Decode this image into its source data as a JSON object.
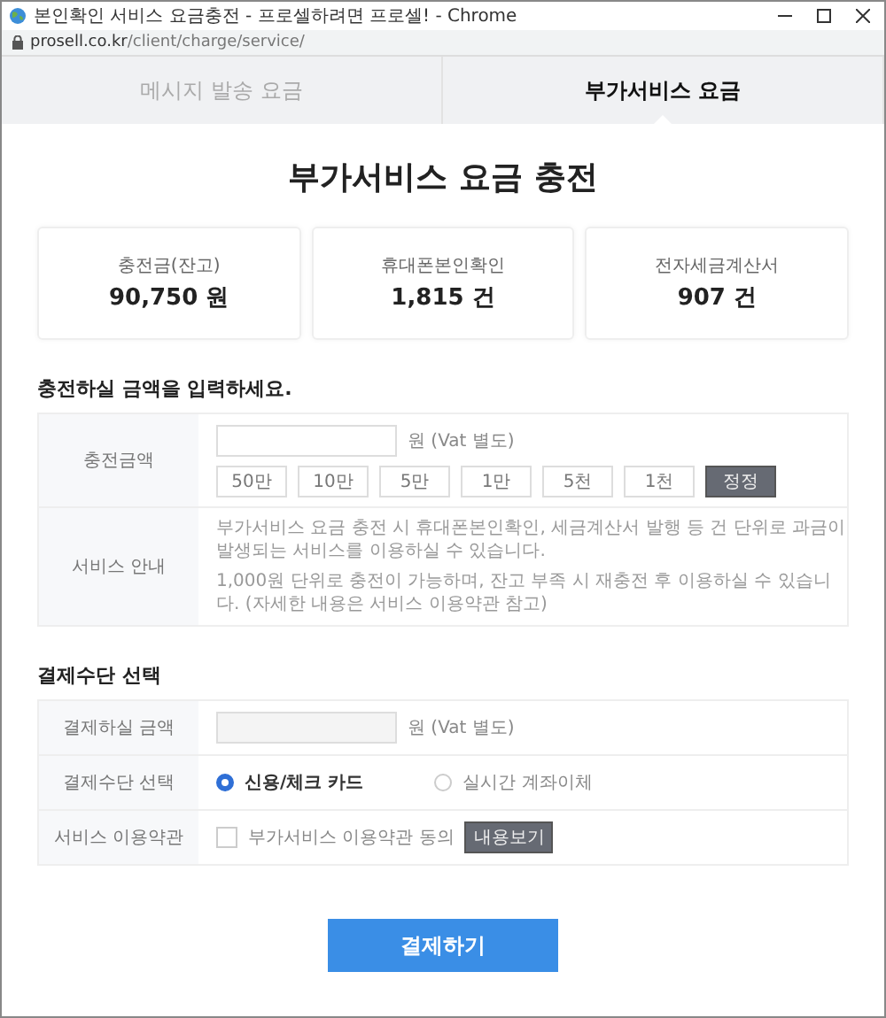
{
  "window": {
    "title": "본인확인 서비스 요금충전 - 프로셀하려면 프로셀! - Chrome",
    "url_domain": "prosell.co.kr",
    "url_path": "/client/charge/service/"
  },
  "tabs": [
    {
      "label": "메시지 발송 요금",
      "selected": false
    },
    {
      "label": "부가서비스 요금",
      "selected": true
    }
  ],
  "page_title": "부가서비스 요금 충전",
  "summary_cards": [
    {
      "label": "충전금(잔고)",
      "value": "90,750 원"
    },
    {
      "label": "휴대폰본인확인",
      "value": "1,815 건"
    },
    {
      "label": "전자세금계산서",
      "value": "907 건"
    }
  ],
  "charge_section": {
    "heading": "충전하실 금액을 입력하세요.",
    "amount_label": "충전금액",
    "unit": "원 (Vat 별도)",
    "amount_buttons": [
      {
        "label": "50만",
        "kind": "amount"
      },
      {
        "label": "10만",
        "kind": "amount"
      },
      {
        "label": "5만",
        "kind": "amount"
      },
      {
        "label": "1만",
        "kind": "amount"
      },
      {
        "label": "5천",
        "kind": "amount"
      },
      {
        "label": "1천",
        "kind": "amount"
      },
      {
        "label": "정정",
        "kind": "reset"
      }
    ],
    "guide_label": "서비스 안내",
    "guide_lines": [
      "부가서비스 요금 충전 시 휴대폰본인확인, 세금계산서 발행 등 건 단위로 과금이 발생되는 서비스를 이용하실 수 있습니다.",
      "1,000원 단위로 충전이 가능하며, 잔고 부족 시 재충전 후 이용하실 수 있습니다. (자세한 내용은 서비스 이용약관 참고)"
    ]
  },
  "payment_section": {
    "heading": "결제수단 선택",
    "amount_label": "결제하실 금액",
    "unit": "원 (Vat 별도)",
    "method_label": "결제수단 선택",
    "methods": [
      {
        "label": "신용/체크 카드",
        "selected": true
      },
      {
        "label": "실시간 계좌이체",
        "selected": false
      }
    ],
    "terms_label": "서비스 이용약관",
    "terms_agree": {
      "label": "부가서비스 이용약관 동의",
      "checked": false
    },
    "terms_button": "내용보기"
  },
  "submit_button": "결제하기"
}
